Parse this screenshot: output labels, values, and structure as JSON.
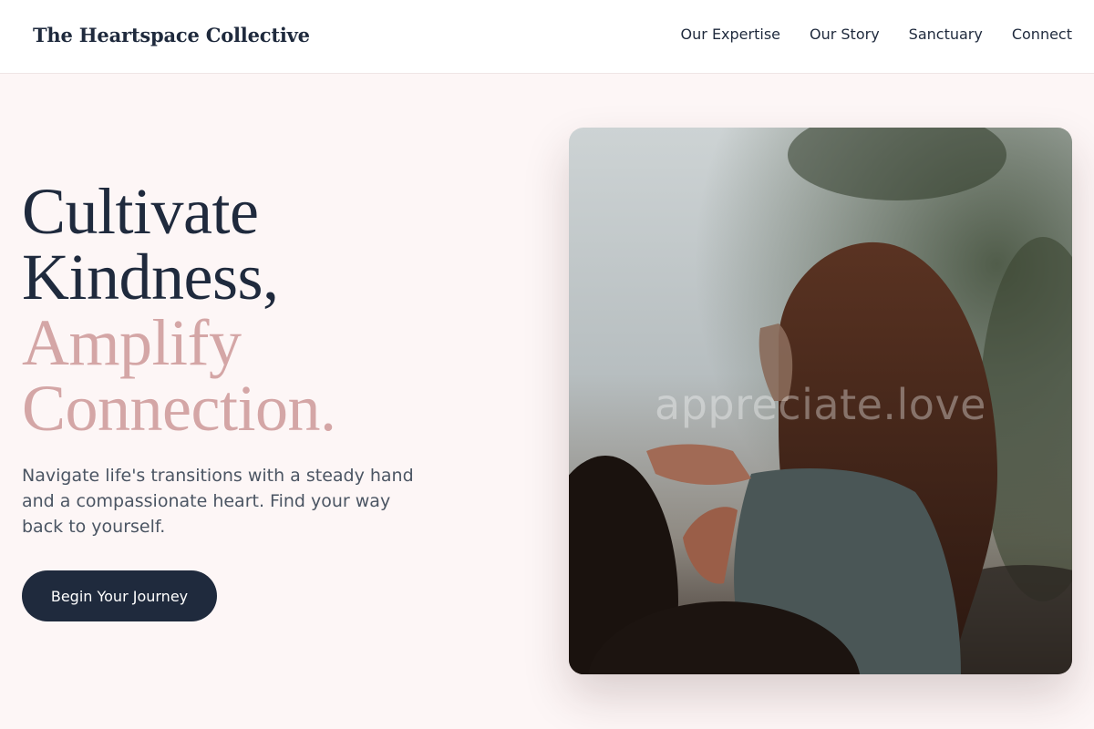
{
  "header": {
    "brand": "The Heartspace Collective",
    "nav": [
      "Our Expertise",
      "Our Story",
      "Sanctuary",
      "Connect"
    ]
  },
  "hero": {
    "headline_line1": "Cultivate",
    "headline_line2": "Kindness,",
    "headline_accent_line1": "Amplify",
    "headline_accent_line2": "Connection.",
    "subtext": "Navigate life's transitions with a steady hand and a compassionate heart. Find your way back to yourself.",
    "cta_label": "Begin Your Journey"
  },
  "image": {
    "watermark": "appreciate.love"
  },
  "colors": {
    "navy": "#1f2a3d",
    "rose": "#d4a6a6",
    "background": "#fdf6f6"
  }
}
